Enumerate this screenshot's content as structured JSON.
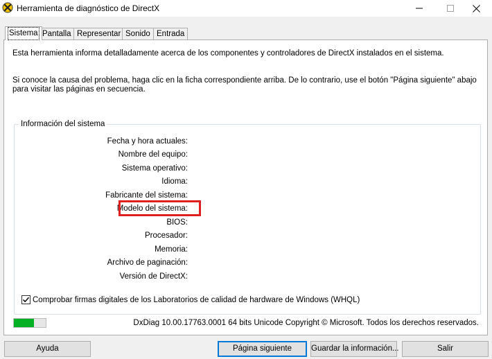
{
  "window": {
    "title": "Herramienta de diagnóstico de DirectX"
  },
  "tabs": [
    {
      "label": "Sistema",
      "active": true
    },
    {
      "label": "Pantalla"
    },
    {
      "label": "Representar"
    },
    {
      "label": "Sonido"
    },
    {
      "label": "Entrada"
    }
  ],
  "intro_text": "Esta herramienta informa detalladamente acerca de los componentes y controladores de DirectX instalados en el sistema.",
  "help_text": "Si conoce la causa del problema, haga clic en la ficha correspondiente arriba. De lo contrario, use el botón \"Página siguiente\" abajo para visitar las páginas en secuencia.",
  "system_info": {
    "group_title": "Información del sistema",
    "labels": [
      "Fecha y hora actuales:",
      "Nombre del equipo:",
      "Sistema operativo:",
      "Idioma:",
      "Fabricante del sistema:",
      "Modelo del sistema:",
      "BIOS:",
      "Procesador:",
      "Memoria:",
      "Archivo de paginación:",
      "Versión de DirectX:"
    ]
  },
  "whql_check": {
    "label": "Comprobar firmas digitales de los Laboratorios de calidad de hardware de Windows (WHQL)",
    "checked": true
  },
  "progress": {
    "fraction": 0.62,
    "color": "#06b025"
  },
  "status_text": "DxDiag 10.00.17763.0001 64 bits Unicode  Copyright © Microsoft. Todos los derechos reservados.",
  "buttons": {
    "help": "Ayuda",
    "next": "Página siguiente",
    "save": "Guardar la información...",
    "exit": "Salir"
  },
  "colors": {
    "highlight": "#e02020",
    "primary_border": "#0078d7"
  }
}
